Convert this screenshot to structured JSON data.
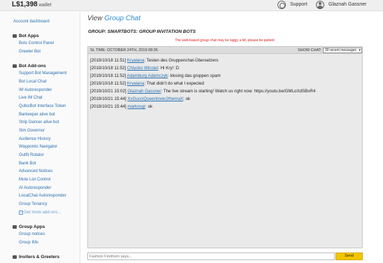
{
  "topbar": {
    "balance": "L$1,398",
    "balance_suffix": "wallet",
    "support_label": "Support",
    "user_name": "Glaznah Gassner"
  },
  "sidebar": {
    "account_dashboard": "Account dashboard",
    "sections": [
      {
        "heading": "Bot Apps",
        "icon": "bot-icon",
        "items": [
          "Bots Control Panel",
          "Greeter Bot"
        ]
      },
      {
        "heading": "Bot Add-ons",
        "icon": "addon-icon",
        "items": [
          "Support Bot Management",
          "Bot Local Chat",
          "IM Autoresponder",
          "Live IM Chat",
          "QubicBot Interface Token",
          "Barkeeper alive bot",
          "Strip Dancer alive bot",
          "Sim Governor",
          "Audience History",
          "Waypoints Navigator",
          "Outfit Rotator",
          "Bank Bot",
          "Advanced Notices",
          "Mute List Control",
          "AI Autoresponder",
          "LocalChat Autoresponder",
          "Group Tenancy"
        ]
      },
      {
        "heading": "Group Apps",
        "icon": "group-icon",
        "items": [
          "Group notices",
          "Group IMs"
        ]
      },
      {
        "heading": "Inviters & Greeters",
        "icon": "inviter-icon",
        "items": []
      }
    ],
    "more_addons": "Get more add-ons..."
  },
  "main": {
    "title_prefix": "View",
    "title_accent": "Group Chat",
    "group_label": "GROUP: SMARTBOTS: GROUP INVITATION BOTS",
    "warning": "The web-based group chat may be laggy a bit, please be patient",
    "sl_time": "SL TIME: OCTOBER 24TH, 2019 08:36",
    "show_chat_label": "SHOW CHAT:",
    "show_chat_value": "30 recent messages",
    "messages": [
      {
        "time": "[2019/10/18 11:51]",
        "who": "Kryalana",
        "text": ": Testen des Gruppenchat-Übersetzers"
      },
      {
        "time": "[2019/10/18 11:52]",
        "who": "Chiyoko Winslet",
        "text": ": Hi Kry! :D"
      },
      {
        "time": "[2019/10/18 11:52]",
        "who": "Adamburg Adamczyk",
        "text": ": klosing das gruppen spam"
      },
      {
        "time": "[2019/10/18 11:52]",
        "who": "Kryalana",
        "text": ": That didn't do what I expected"
      },
      {
        "time": "[2019/10/21 15:02]",
        "who": "Glaznah Gassner",
        "text": ": The live stream is starting! Watch us right now: https://youtu.be/GMLoXdSBxR4"
      },
      {
        "time": "[2019/10/21 15:44]",
        "who": "XxGucciQueenlover2themaX",
        "text": ": ok"
      },
      {
        "time": "[2019/10/21 15:44]",
        "who": "markosgr",
        "text": ": ok"
      }
    ],
    "input_placeholder": "Fashion Firethorn says...",
    "send_label": "Send"
  }
}
